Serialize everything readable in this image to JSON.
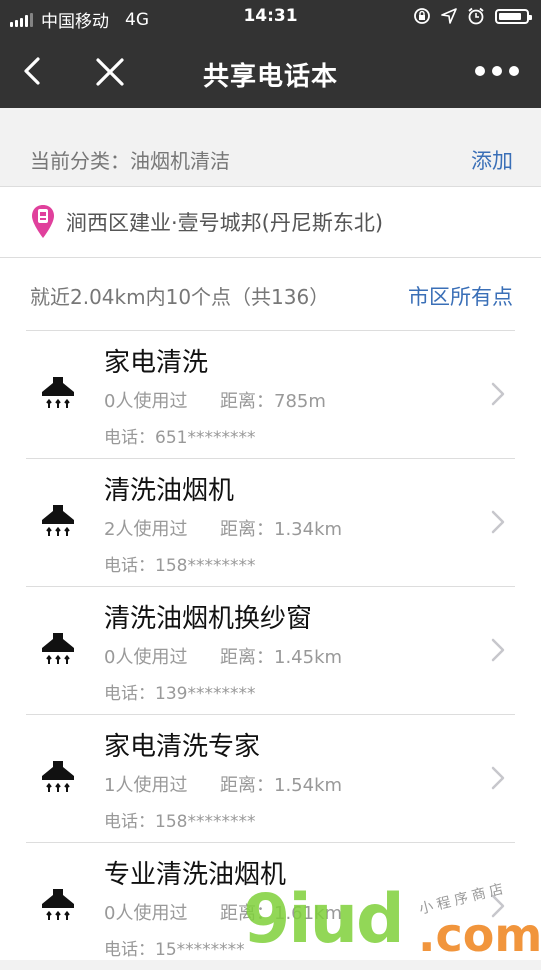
{
  "statusbar": {
    "carrier": "中国移动",
    "network": "4G",
    "time": "14:31"
  },
  "navbar": {
    "title": "共享电话本"
  },
  "category": {
    "label": "当前分类：油烟机清洁",
    "add": "添加"
  },
  "location": {
    "text": "涧西区建业·壹号城邦(丹尼斯东北)"
  },
  "summary": {
    "text": "就近2.04km内10个点（共136）",
    "all": "市区所有点"
  },
  "items": [
    {
      "name": "家电清洗",
      "used": "0人使用过",
      "distance": "距离：785m",
      "phone": "电话：651********"
    },
    {
      "name": "清洗油烟机",
      "used": "2人使用过",
      "distance": "距离：1.34km",
      "phone": "电话：158********"
    },
    {
      "name": "清洗油烟机换纱窗",
      "used": "0人使用过",
      "distance": "距离：1.45km",
      "phone": "电话：139********"
    },
    {
      "name": "家电清洗专家",
      "used": "1人使用过",
      "distance": "距离：1.54km",
      "phone": "电话：158********"
    },
    {
      "name": "专业清洗油烟机",
      "used": "0人使用过",
      "distance": "距离：1.61km",
      "phone": "电话：15********"
    }
  ],
  "watermark": {
    "main": "9iud",
    "suffix": ".com",
    "tag": "小程序商店"
  },
  "colors": {
    "bar": "#333333",
    "link": "#3a6fb7",
    "pin": "#e0409c"
  }
}
